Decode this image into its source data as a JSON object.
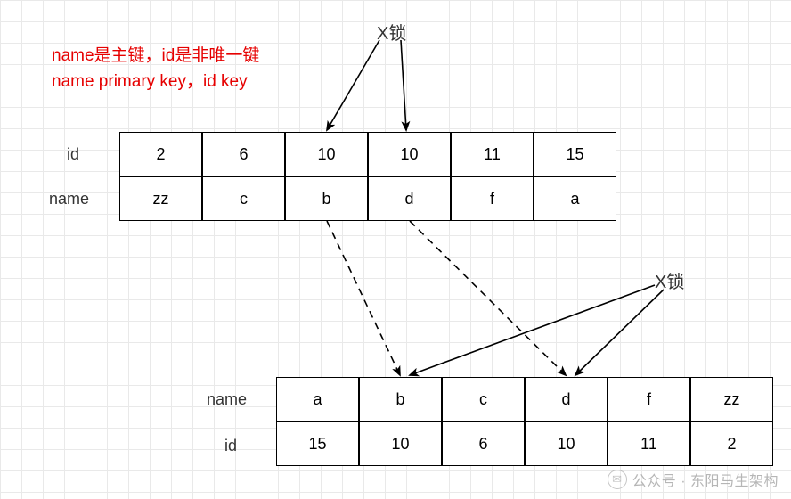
{
  "lock_label_top": "X锁",
  "lock_label_bottom": "X锁",
  "note_line1": "name是主键，id是非唯一键",
  "note_line2": "name primary key，id key",
  "table1": {
    "headers": {
      "row1": "id",
      "row2": "name"
    },
    "row1": [
      "2",
      "6",
      "10",
      "10",
      "11",
      "15"
    ],
    "row2": [
      "zz",
      "c",
      "b",
      "d",
      "f",
      "a"
    ]
  },
  "table2": {
    "headers": {
      "row1": "name",
      "row2": "id"
    },
    "row1": [
      "a",
      "b",
      "c",
      "d",
      "f",
      "zz"
    ],
    "row2": [
      "15",
      "10",
      "6",
      "10",
      "11",
      "2"
    ]
  },
  "watermark": "公众号 · 东阳马生架构"
}
